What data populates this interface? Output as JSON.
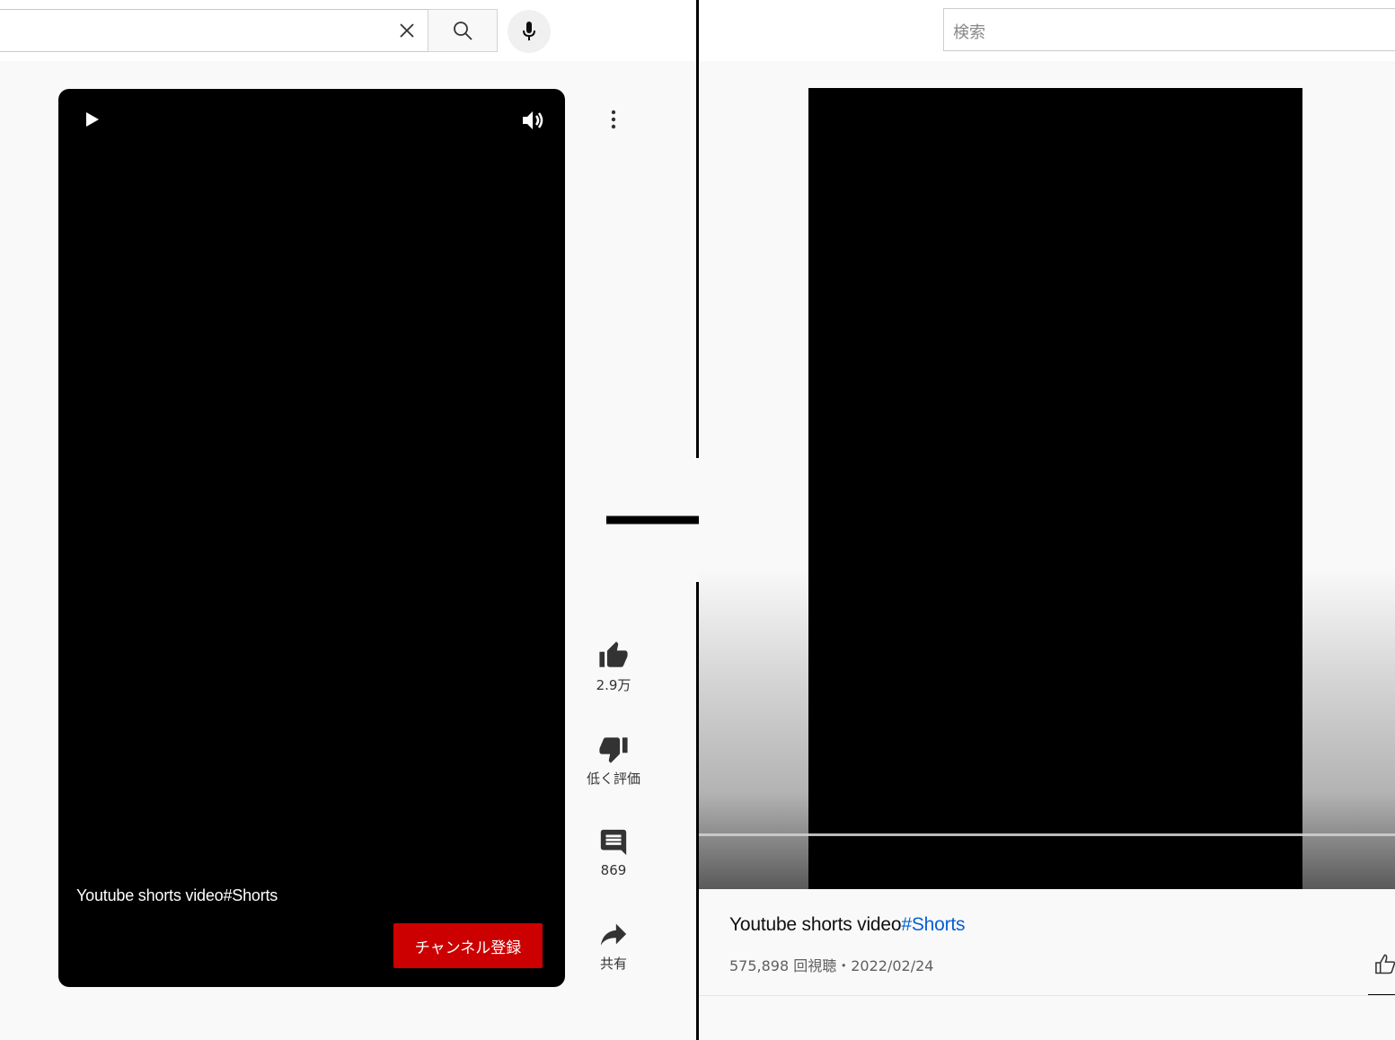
{
  "left": {
    "search": {
      "value": ""
    },
    "short": {
      "title": "Youtube shorts video#Shorts",
      "subscribe_label": "チャンネル登録"
    },
    "actions": {
      "like_count": "2.9万",
      "dislike_label": "低く評価",
      "comment_count": "869",
      "share_label": "共有"
    }
  },
  "right": {
    "search": {
      "placeholder": "検索"
    },
    "video": {
      "title_text": "Youtube shorts video",
      "hashtag": "#Shorts",
      "meta": "575,898 回視聴・2022/02/24"
    }
  },
  "icons": [
    "clear-icon",
    "search-icon",
    "mic-icon",
    "play-icon",
    "volume-icon",
    "more-vert-icon",
    "thumb-up-icon",
    "thumb-down-icon",
    "comment-icon",
    "share-icon",
    "arrow-right-icon"
  ],
  "colors": {
    "subscribe": "#cc0000",
    "hashtag": "#065fd4",
    "player": "#000000"
  }
}
